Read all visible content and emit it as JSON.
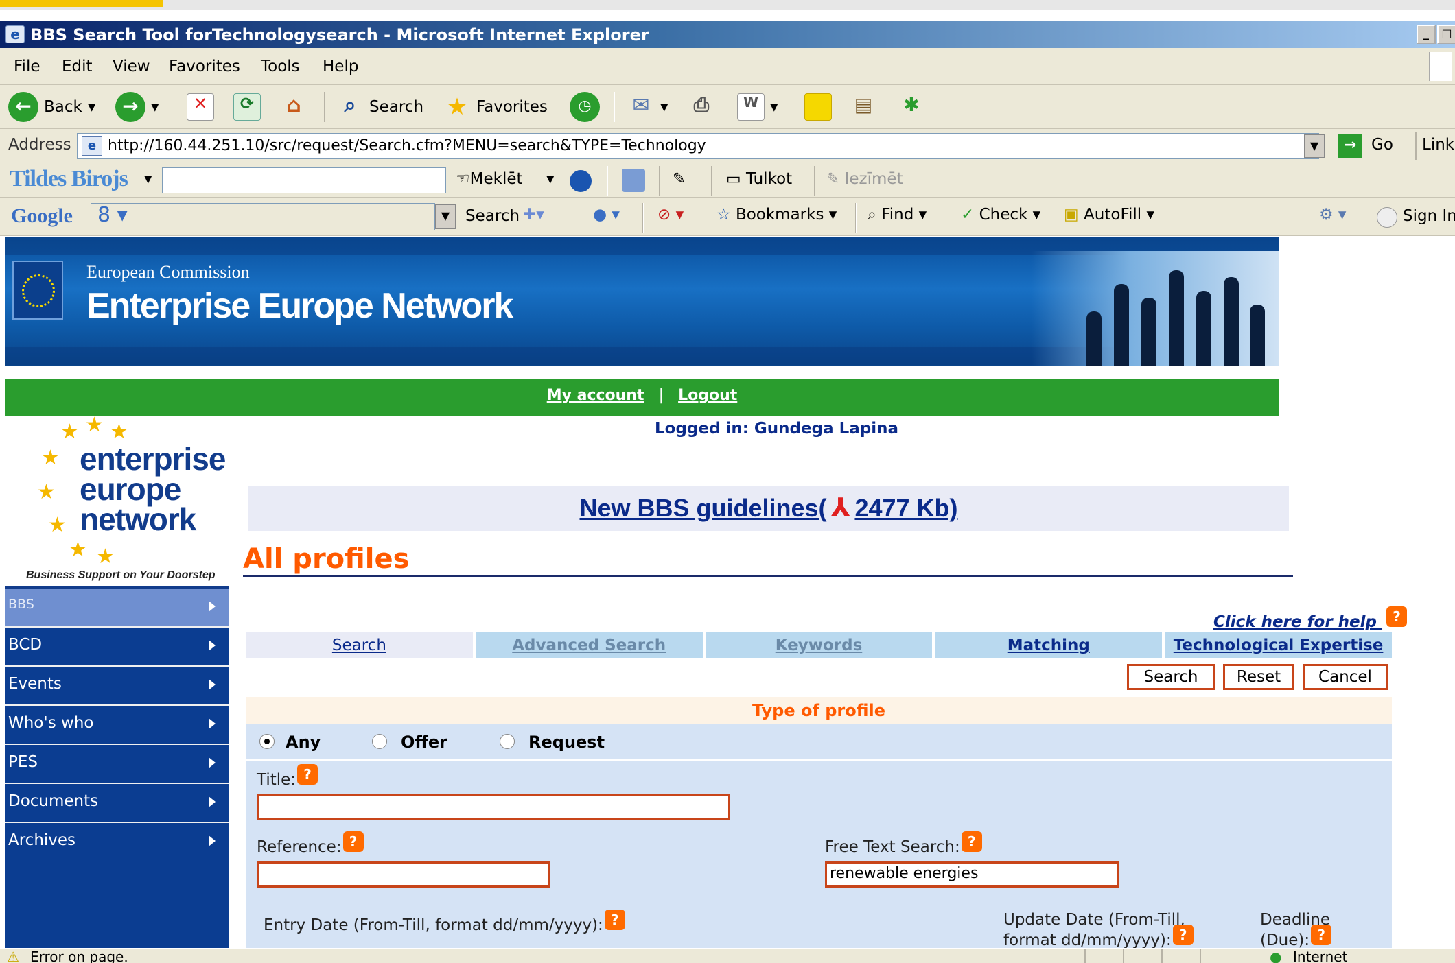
{
  "window": {
    "title": "BBS Search Tool forTechnologysearch - Microsoft Internet Explorer"
  },
  "menu": [
    "File",
    "Edit",
    "View",
    "Favorites",
    "Tools",
    "Help"
  ],
  "toolbar": {
    "back": "Back",
    "search": "Search",
    "favorites": "Favorites"
  },
  "address": {
    "label": "Address",
    "url": "http://160.44.251.10/src/request/Search.cfm?MENU=search&TYPE=Technology",
    "go": "Go",
    "links": "Links"
  },
  "tildes_bar": {
    "brand": "Tildes Birojs",
    "meklet": "Meklēt",
    "tulkot": "Tulkot",
    "iezimet": "Iezīmēt"
  },
  "google_bar": {
    "logo": "Google",
    "search": "Search",
    "bookmarks": "Bookmarks",
    "find": "Find",
    "check": "Check",
    "autofill": "AutoFill",
    "sign_in": "Sign In"
  },
  "banner": {
    "org": "European Commission",
    "network": "Enterprise Europe Network"
  },
  "top_nav": {
    "my_account": "My account",
    "logout": "Logout"
  },
  "logged_in": "Logged in: Gundega Lapina",
  "logo": {
    "line1": "enterprise",
    "line2": "europe",
    "line3": "network",
    "tagline": "Business Support on Your Doorstep"
  },
  "side_nav": [
    {
      "label": "BBS"
    },
    {
      "label": "BCD"
    },
    {
      "label": "Events"
    },
    {
      "label": "Who's who"
    },
    {
      "label": "PES"
    },
    {
      "label": "Documents"
    },
    {
      "label": "Archives"
    }
  ],
  "guidelines": {
    "link": "New BBS guidelines(",
    "size": "2477 Kb)"
  },
  "page_title": "All profiles",
  "help_link": "Click here for help",
  "help_icon": "?",
  "tabs": [
    "Search",
    "Advanced Search",
    "Keywords",
    "Matching",
    "Technological Expertise"
  ],
  "actions": {
    "search": "Search",
    "reset": "Reset",
    "cancel": "Cancel"
  },
  "type_of_profile": {
    "header": "Type of profile",
    "options": [
      "Any",
      "Offer",
      "Request"
    ],
    "selected": "Any"
  },
  "form": {
    "title_label": "Title:",
    "title_value": "",
    "reference_label": "Reference:",
    "reference_value": "",
    "free_text_label": "Free Text Search:",
    "free_text_value": "renewable energies",
    "entry_date_label": "Entry Date (From-Till, format dd/mm/yyyy):",
    "update_date_label": "Update Date (From-Till,",
    "update_date_label2": "format dd/mm/yyyy):",
    "deadline_label": "Deadline",
    "deadline_label2": "(Due):"
  },
  "status": {
    "text": "Error on page.",
    "zone": "Internet"
  },
  "colors": {
    "accent_orange": "#ff5a00",
    "nav_blue": "#0b3d91",
    "green_bar": "#2a9d2e",
    "input_border": "#c8451a"
  }
}
